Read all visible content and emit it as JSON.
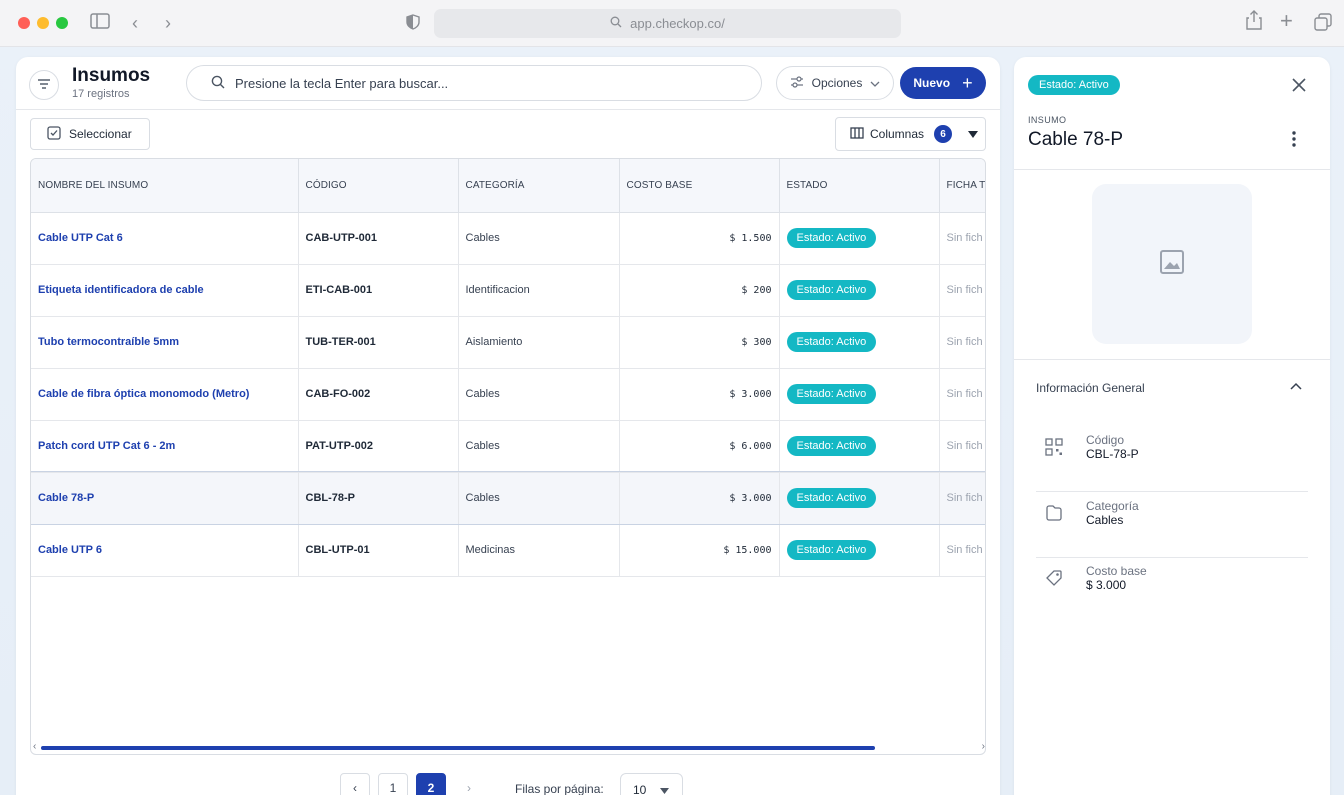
{
  "browser": {
    "url": "app.checkop.co/"
  },
  "header": {
    "title": "Insumos",
    "subtitle": "17 registros",
    "search_placeholder": "Presione la tecla Enter para buscar...",
    "options_label": "Opciones",
    "new_label": "Nuevo",
    "select_label": "Seleccionar",
    "columns_label": "Columnas",
    "columns_count": "6"
  },
  "table": {
    "columns": [
      "NOMBRE DEL INSUMO",
      "CÓDIGO",
      "CATEGORÍA",
      "COSTO BASE",
      "ESTADO",
      "FICHA T"
    ],
    "rows": [
      {
        "name": "Cable UTP Cat 6",
        "code": "CAB-UTP-001",
        "category": "Cables",
        "cost": "$ 1.500",
        "status": "Estado: Activo",
        "ficha": "Sin fich"
      },
      {
        "name": "Etiqueta identificadora de cable",
        "code": "ETI-CAB-001",
        "category": "Identificacion",
        "cost": "$ 200",
        "status": "Estado: Activo",
        "ficha": "Sin fich"
      },
      {
        "name": "Tubo termocontraíble 5mm",
        "code": "TUB-TER-001",
        "category": "Aislamiento",
        "cost": "$ 300",
        "status": "Estado: Activo",
        "ficha": "Sin fich"
      },
      {
        "name": "Cable de fibra óptica monomodo (Metro)",
        "code": "CAB-FO-002",
        "category": "Cables",
        "cost": "$ 3.000",
        "status": "Estado: Activo",
        "ficha": "Sin fich"
      },
      {
        "name": "Patch cord UTP Cat 6 - 2m",
        "code": "PAT-UTP-002",
        "category": "Cables",
        "cost": "$ 6.000",
        "status": "Estado: Activo",
        "ficha": "Sin fich"
      },
      {
        "name": "Cable 78-P",
        "code": "CBL-78-P",
        "category": "Cables",
        "cost": "$ 3.000",
        "status": "Estado: Activo",
        "ficha": "Sin fich"
      },
      {
        "name": "Cable UTP 6",
        "code": "CBL-UTP-01",
        "category": "Medicinas",
        "cost": "$ 15.000",
        "status": "Estado: Activo",
        "ficha": "Sin fich"
      }
    ]
  },
  "pagination": {
    "page1": "1",
    "page2": "2",
    "rows_label": "Filas por página:",
    "rows_value": "10"
  },
  "detail": {
    "status": "Estado: Activo",
    "label": "INSUMO",
    "name": "Cable 78-P",
    "section_title": "Información General",
    "fields": [
      {
        "key": "Código",
        "value": "CBL-78-P",
        "icon": "qr-code-icon"
      },
      {
        "key": "Categoría",
        "value": "Cables",
        "icon": "folder-icon"
      },
      {
        "key": "Costo base",
        "value": "$ 3.000",
        "icon": "tag-icon"
      }
    ]
  },
  "colors": {
    "primary": "#1e40af",
    "status_teal": "#14b8c4"
  }
}
